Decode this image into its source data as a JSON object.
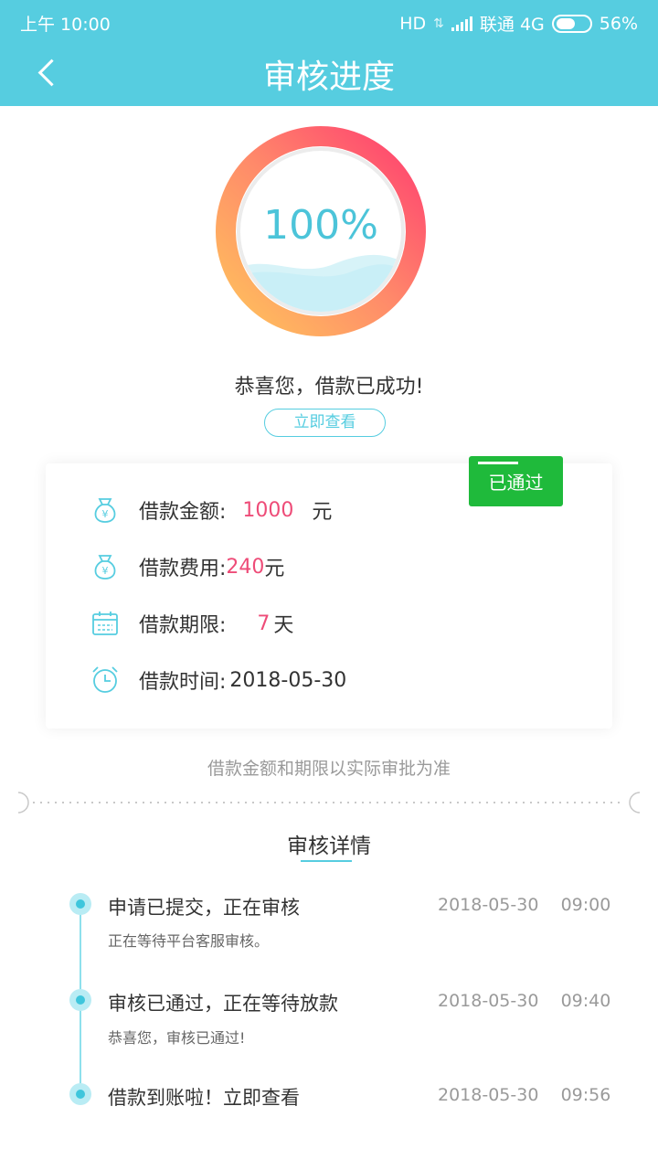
{
  "status_bar": {
    "time": "上午 10:00",
    "network": "HD",
    "carrier": "联通 4G",
    "battery": "56%"
  },
  "header": {
    "title": "审核进度"
  },
  "progress": {
    "percent_text": "100%",
    "value": 1.0
  },
  "result": {
    "message": "恭喜您，借款已成功!",
    "view_button": "立即查看"
  },
  "card": {
    "badge": "已通过",
    "amount": {
      "label": "借款金额:",
      "value": "1000",
      "unit": "元",
      "icon": "money-bag-icon"
    },
    "fee": {
      "label": "借款费用:",
      "value": "240",
      "unit": "元",
      "icon": "money-bag-icon"
    },
    "term": {
      "label": "借款期限:",
      "value": "7",
      "unit": "天",
      "icon": "calendar-icon"
    },
    "time": {
      "label": "借款时间:",
      "value": "2018-05-30",
      "icon": "alarm-clock-icon"
    }
  },
  "note": "借款金额和期限以实际审批为准",
  "details": {
    "title": "审核详情",
    "events": [
      {
        "title": "申请已提交，正在审核",
        "subtitle": "正在等待平台客服审核。",
        "time": "2018-05-30    09:00"
      },
      {
        "title": "审核已通过，正在等待放款",
        "subtitle": "恭喜您，审核已通过!",
        "time": "2018-05-30    09:40"
      },
      {
        "title": "借款到账啦！立即查看",
        "subtitle": "",
        "time": "2018-05-30    09:56"
      }
    ]
  },
  "colors": {
    "accent": "#56cde0",
    "highlight": "#ee4c78",
    "badge": "#1fba3b",
    "ring_start": "#ffb85a",
    "ring_end": "#ff4a72"
  }
}
